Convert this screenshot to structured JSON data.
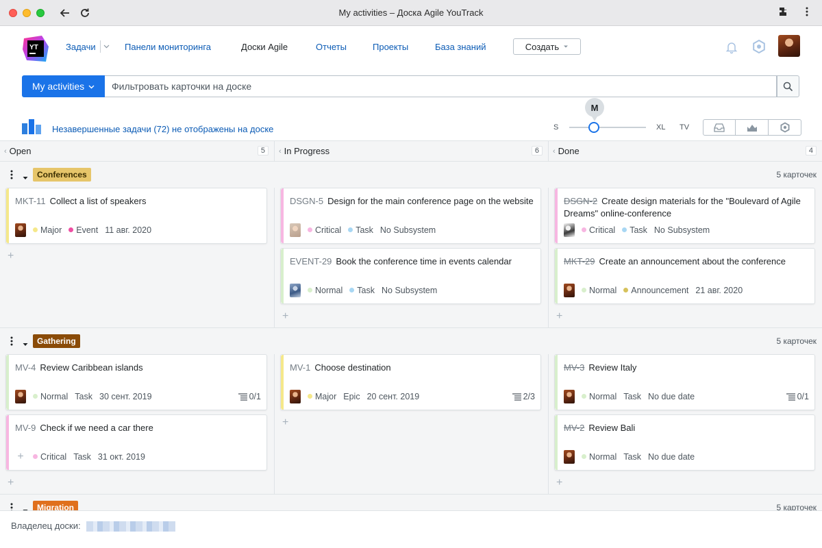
{
  "window": {
    "title": "My activities – Доска Agile YouTrack"
  },
  "nav": {
    "items": [
      {
        "label": "Задачи",
        "active": false
      },
      {
        "label": "Панели мониторинга",
        "active": false
      },
      {
        "label": "Доски Agile",
        "active": true
      },
      {
        "label": "Отчеты",
        "active": false
      },
      {
        "label": "Проекты",
        "active": false
      },
      {
        "label": "База знаний",
        "active": false
      }
    ],
    "create_label": "Создать"
  },
  "search": {
    "board_label": "My activities",
    "placeholder": "Фильтровать карточки на доске"
  },
  "toolbar": {
    "unfinished_text": "Незавершенные задачи (72) не отображены на доске",
    "size_options": [
      "S",
      "XL",
      "TV"
    ],
    "size_selected": "M"
  },
  "columns": [
    {
      "name": "Open",
      "count": "5"
    },
    {
      "name": "In Progress",
      "count": "6"
    },
    {
      "name": "Done",
      "count": "4"
    }
  ],
  "swimlanes": [
    {
      "name": "Conferences",
      "count_label": "5 карточек",
      "color": "#e6c56a",
      "text_color": "#3a2d00",
      "columns": [
        [
          {
            "id": "MKT-11",
            "title": "Collect a list of speakers",
            "done": false,
            "stripe": "#f5e88a",
            "avatar": "main",
            "fields": [
              {
                "dot": "#f5e88a",
                "text": "Major"
              },
              {
                "dot": "#ee4fa3",
                "text": "Event"
              },
              {
                "text": "11 авг. 2020"
              }
            ]
          }
        ],
        [
          {
            "id": "DSGN-5",
            "title": "Design for the main conference page on the website",
            "done": false,
            "stripe": "#f7b6e1",
            "avatar": "alt",
            "fields": [
              {
                "dot": "#f7b6e1",
                "text": "Critical"
              },
              {
                "dot": "#a8d7f3",
                "text": "Task"
              },
              {
                "text": "No Subsystem"
              }
            ]
          },
          {
            "id": "EVENT-29",
            "title": "Book the conference time in events calendar",
            "done": false,
            "stripe": "#d8efcc",
            "avatar": "alt3",
            "fields": [
              {
                "dot": "#d8efcc",
                "text": "Normal"
              },
              {
                "dot": "#a8d7f3",
                "text": "Task"
              },
              {
                "text": "No Subsystem"
              }
            ]
          }
        ],
        [
          {
            "id": "DSGN-2",
            "title": "Create design materials for the \"Boulevard of Agile Dreams\" online-conference",
            "done": true,
            "stripe": "#f7b6e1",
            "avatar": "alt2",
            "fields": [
              {
                "dot": "#f7b6e1",
                "text": "Critical"
              },
              {
                "dot": "#a8d7f3",
                "text": "Task"
              },
              {
                "text": "No Subsystem"
              }
            ]
          },
          {
            "id": "MKT-29",
            "title": "Create an announcement about the conference",
            "done": true,
            "stripe": "#d8efcc",
            "avatar": "main",
            "fields": [
              {
                "dot": "#d8efcc",
                "text": "Normal"
              },
              {
                "dot": "#d6c25c",
                "text": "Announcement"
              },
              {
                "text": "21 авг. 2020"
              }
            ]
          }
        ]
      ]
    },
    {
      "name": "Gathering",
      "count_label": "5 карточек",
      "color": "#8a4b08",
      "text_color": "#ffffff",
      "columns": [
        [
          {
            "id": "MV-4",
            "title": "Review Caribbean islands",
            "done": false,
            "stripe": "#d8efcc",
            "avatar": "main",
            "fields": [
              {
                "dot": "#d8efcc",
                "text": "Normal"
              },
              {
                "text": "Task"
              },
              {
                "text": "30 сент. 2019"
              }
            ],
            "checklist": "0/1"
          },
          {
            "id": "MV-9",
            "title": "Check if we need a car there",
            "done": false,
            "stripe": "#f7b6e1",
            "avatar": "none",
            "fields": [
              {
                "dot": "#f7b6e1",
                "text": "Critical"
              },
              {
                "text": "Task"
              },
              {
                "text": "31 окт. 2019"
              }
            ]
          }
        ],
        [
          {
            "id": "MV-1",
            "title": "Choose destination",
            "done": false,
            "stripe": "#f5e88a",
            "avatar": "main",
            "fields": [
              {
                "dot": "#f5e88a",
                "text": "Major"
              },
              {
                "text": "Epic"
              },
              {
                "text": "20 сент. 2019"
              }
            ],
            "checklist": "2/3"
          }
        ],
        [
          {
            "id": "MV-3",
            "title": "Review Italy",
            "done": true,
            "stripe": "#d8efcc",
            "avatar": "main",
            "fields": [
              {
                "dot": "#d8efcc",
                "text": "Normal"
              },
              {
                "text": "Task"
              },
              {
                "text": "No due date"
              }
            ],
            "checklist": "0/1"
          },
          {
            "id": "MV-2",
            "title": "Review Bali",
            "done": true,
            "stripe": "#d8efcc",
            "avatar": "main",
            "fields": [
              {
                "dot": "#d8efcc",
                "text": "Normal"
              },
              {
                "text": "Task"
              },
              {
                "text": "No due date"
              }
            ]
          }
        ]
      ]
    },
    {
      "name": "Migration",
      "count_label": "5 карточек",
      "color": "#e0701d",
      "text_color": "#ffffff",
      "columns": []
    }
  ],
  "footer": {
    "owner_label": "Владелец доски:"
  },
  "colors": {
    "accent": "#1a73e8",
    "link": "#0b5bb5"
  }
}
